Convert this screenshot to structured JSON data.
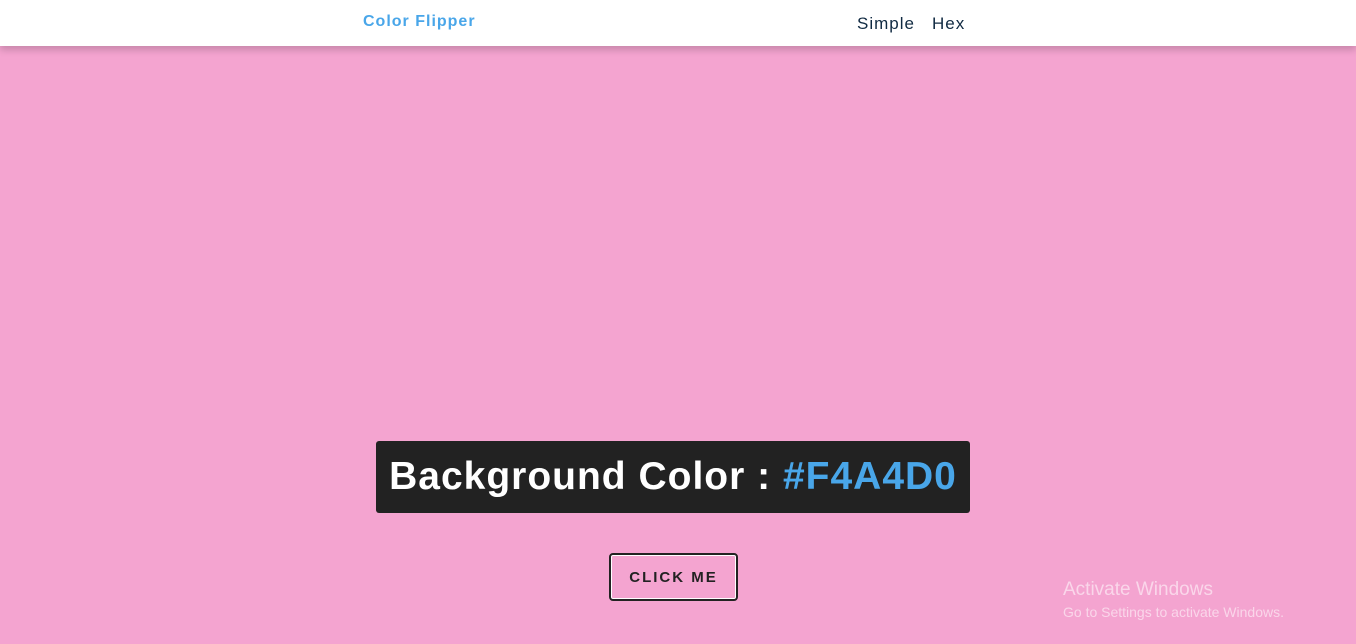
{
  "nav": {
    "brand": "Color Flipper",
    "links": [
      "Simple",
      "Hex"
    ]
  },
  "main": {
    "label": "Background Color : ",
    "color_value": "#F4A4D0",
    "button_label": "CLICK ME"
  },
  "watermark": {
    "title": "Activate Windows",
    "subtitle": "Go to Settings to activate Windows."
  },
  "colors": {
    "background": "#F4A4D0",
    "accent": "#49A6E9",
    "panel": "#222222",
    "nav_text": "#102A42"
  }
}
